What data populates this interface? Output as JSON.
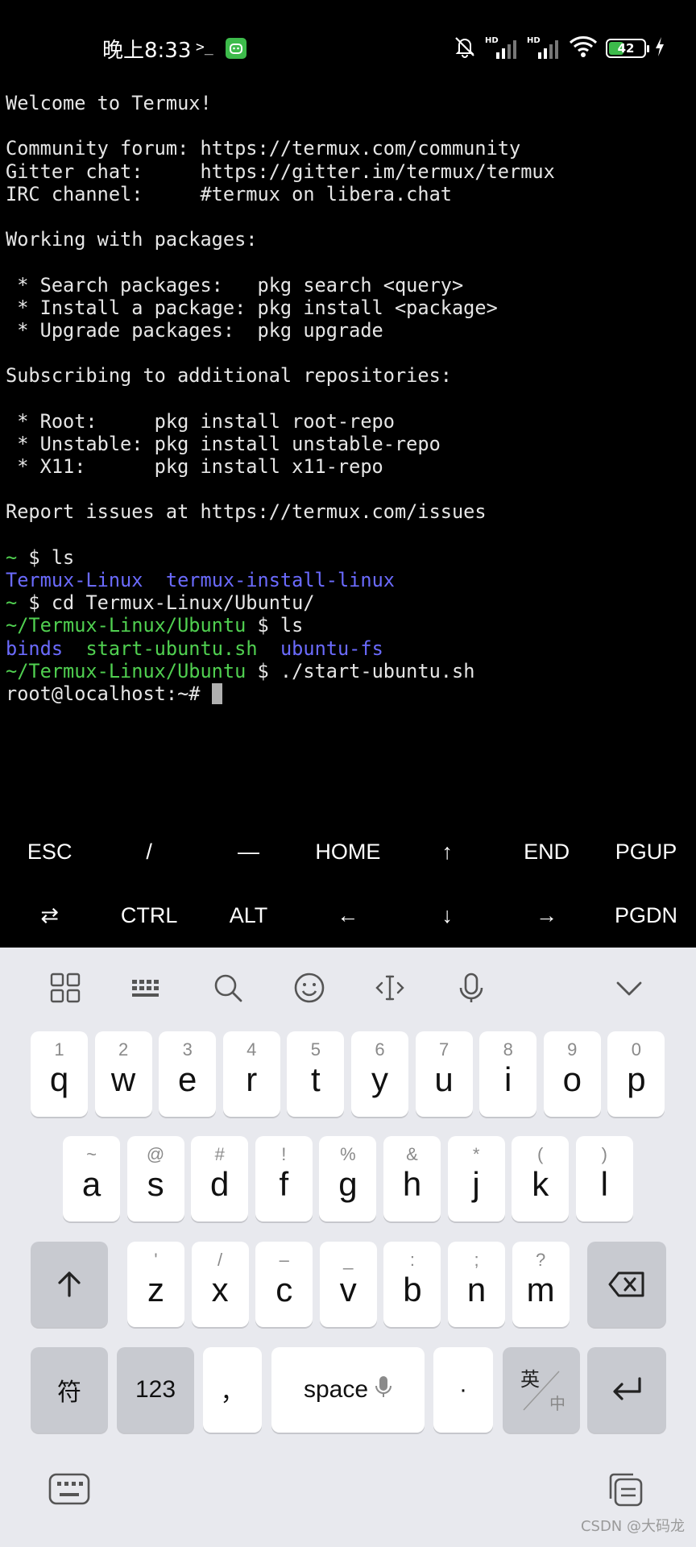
{
  "status_bar": {
    "time": "晚上8:33",
    "terminal_glyph": ">_",
    "signal_1_label": "HD",
    "signal_2_label": "HD",
    "battery_level": "42",
    "battery_fraction": 0.42
  },
  "terminal": {
    "lines": [
      [
        {
          "t": "Welcome to Termux!"
        }
      ],
      [],
      [
        {
          "t": "Community forum: https://termux.com/community"
        }
      ],
      [
        {
          "t": "Gitter chat:     https://gitter.im/termux/termux"
        }
      ],
      [
        {
          "t": "IRC channel:     #termux on libera.chat"
        }
      ],
      [],
      [
        {
          "t": "Working with packages:"
        }
      ],
      [],
      [
        {
          "t": " * Search packages:   pkg search <query>"
        }
      ],
      [
        {
          "t": " * Install a package: pkg install <package>"
        }
      ],
      [
        {
          "t": " * Upgrade packages:  pkg upgrade"
        }
      ],
      [],
      [
        {
          "t": "Subscribing to additional repositories:"
        }
      ],
      [],
      [
        {
          "t": " * Root:     pkg install root-repo"
        }
      ],
      [
        {
          "t": " * Unstable: pkg install unstable-repo"
        }
      ],
      [
        {
          "t": " * X11:      pkg install x11-repo"
        }
      ],
      [],
      [
        {
          "t": "Report issues at https://termux.com/issues"
        }
      ],
      [],
      [
        {
          "t": "~",
          "c": "green"
        },
        {
          "t": " $ ls"
        }
      ],
      [
        {
          "t": "Termux-Linux",
          "c": "dir"
        },
        {
          "t": "  "
        },
        {
          "t": "termux-install-linux",
          "c": "dir"
        }
      ],
      [
        {
          "t": "~",
          "c": "green"
        },
        {
          "t": " $ cd Termux-Linux/Ubuntu/"
        }
      ],
      [
        {
          "t": "~/Termux-Linux/Ubuntu",
          "c": "green"
        },
        {
          "t": " $ ls"
        }
      ],
      [
        {
          "t": "binds",
          "c": "dir"
        },
        {
          "t": "  "
        },
        {
          "t": "start-ubuntu.sh",
          "c": "exec"
        },
        {
          "t": "  "
        },
        {
          "t": "ubuntu-fs",
          "c": "dir"
        }
      ],
      [
        {
          "t": "~/Termux-Linux/Ubuntu",
          "c": "green"
        },
        {
          "t": " $ ./start-ubuntu.sh"
        }
      ],
      [
        {
          "t": "root@localhost:~# "
        },
        {
          "cursor": true
        }
      ]
    ]
  },
  "extra_keys": {
    "row1": [
      "ESC",
      "/",
      "—",
      "HOME",
      "↑",
      "END",
      "PGUP"
    ],
    "row2": [
      "⇄",
      "CTRL",
      "ALT",
      "←",
      "↓",
      "→",
      "PGDN"
    ]
  },
  "keyboard": {
    "toolbar_icons": [
      "apps-grid-icon",
      "keyboard-layout-icon",
      "search-icon",
      "emoji-icon",
      "cursor-move-icon",
      "microphone-icon",
      "collapse-chevron-icon"
    ],
    "row1": [
      {
        "hint": "1",
        "key": "q"
      },
      {
        "hint": "2",
        "key": "w"
      },
      {
        "hint": "3",
        "key": "e"
      },
      {
        "hint": "4",
        "key": "r"
      },
      {
        "hint": "5",
        "key": "t"
      },
      {
        "hint": "6",
        "key": "y"
      },
      {
        "hint": "7",
        "key": "u"
      },
      {
        "hint": "8",
        "key": "i"
      },
      {
        "hint": "9",
        "key": "o"
      },
      {
        "hint": "0",
        "key": "p"
      }
    ],
    "row2": [
      {
        "hint": "~",
        "key": "a"
      },
      {
        "hint": "@",
        "key": "s"
      },
      {
        "hint": "#",
        "key": "d"
      },
      {
        "hint": "!",
        "key": "f"
      },
      {
        "hint": "%",
        "key": "g"
      },
      {
        "hint": "&",
        "key": "h"
      },
      {
        "hint": "*",
        "key": "j"
      },
      {
        "hint": "(",
        "key": "k"
      },
      {
        "hint": ")",
        "key": "l"
      }
    ],
    "row3": [
      {
        "hint": "'",
        "key": "z"
      },
      {
        "hint": "/",
        "key": "x"
      },
      {
        "hint": "–",
        "key": "c"
      },
      {
        "hint": "_",
        "key": "v"
      },
      {
        "hint": ":",
        "key": "b"
      },
      {
        "hint": ";",
        "key": "n"
      },
      {
        "hint": "?",
        "key": "m"
      }
    ],
    "symbols_label": "符",
    "numbers_label": "123",
    "comma_label": "，",
    "space_label": "space",
    "period_label": "·",
    "lang_top": "英",
    "lang_bottom": "中"
  },
  "watermark": "CSDN @大码龙"
}
